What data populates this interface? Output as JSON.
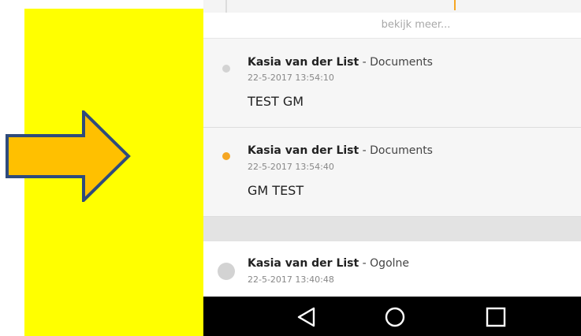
{
  "timeline": {
    "more_label": "bekijk meer...",
    "entries": [
      {
        "author": "Kasia van der List",
        "separator": " - ",
        "category": "Documents",
        "timestamp": "22-5-2017 13:54:10",
        "message": "TEST GM",
        "active": false
      },
      {
        "author": "Kasia van der List",
        "separator": " - ",
        "category": "Documents",
        "timestamp": "22-5-2017 13:54:40",
        "message": "GM TEST",
        "active": true
      },
      {
        "author": "Kasia van der List",
        "separator": " - ",
        "category": "Ogolne",
        "timestamp": "22-5-2017 13:40:48",
        "message": "",
        "active": false
      }
    ]
  },
  "navbar": {
    "buttons": [
      "back-triangle",
      "home-circle",
      "recents-square"
    ]
  },
  "colors": {
    "highlight_panel": "#ffff00",
    "arrow_fill": "#ffc000",
    "arrow_stroke": "#2f4b7c",
    "accent": "#f5a623",
    "navbar": "#000000"
  }
}
